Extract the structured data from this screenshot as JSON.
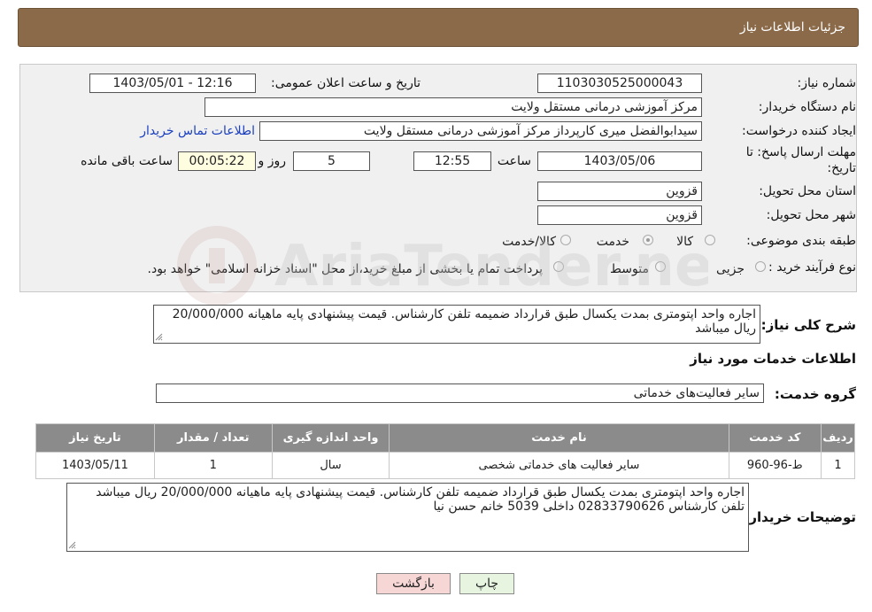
{
  "header": {
    "title": "جزئیات اطلاعات نیاز"
  },
  "fields": {
    "need_number_label": "شماره نیاز:",
    "need_number": "1103030525000043",
    "announce_label": "تاریخ و ساعت اعلان عمومی:",
    "announce_value": "1403/05/01 - 12:16",
    "buyer_org_label": "نام دستگاه خریدار:",
    "buyer_org": "مرکز آموزشی درمانی مستقل ولایت",
    "requester_label": "ایجاد کننده درخواست:",
    "requester": "سیدابوالفضل میری کارپرداز مرکز آموزشی درمانی مستقل ولایت",
    "contact_link": "اطلاعات تماس خریدار",
    "deadline_label_1": "مهلت ارسال پاسخ: تا",
    "deadline_label_2": "تاریخ:",
    "deadline_date": "1403/05/06",
    "time_label": "ساعت",
    "deadline_time": "12:55",
    "days_value": "5",
    "days_label": "روز و",
    "remaining_time": "00:05:22",
    "remaining_label": "ساعت باقی مانده",
    "province_label": "استان محل تحویل:",
    "province": "قزوین",
    "city_label": "شهر محل تحویل:",
    "city": "قزوین",
    "category_label": "طبقه بندی موضوعی:",
    "category_options": [
      "کالا",
      "خدمت",
      "کالا/خدمت"
    ],
    "process_label": "نوع فرآیند خرید :",
    "process_options": [
      "جزیی",
      "متوسط"
    ],
    "process_note": "پرداخت تمام یا بخشی از مبلغ خرید،از محل \"اسناد خزانه اسلامی\" خواهد بود."
  },
  "summary": {
    "label": "شرح کلی نیاز:",
    "text": "اجاره واحد اپتومتری بمدت یکسال طبق قرارداد ضمیمه تلفن کارشناس. قیمت پیشنهادی پایه ماهیانه 20/000/000 ریال میباشد"
  },
  "services": {
    "section_title": "اطلاعات خدمات مورد نیاز",
    "group_label": "گروه خدمت:",
    "group_value": "سایر فعالیت‌های خدماتی",
    "columns": [
      "ردیف",
      "کد خدمت",
      "نام خدمت",
      "واحد اندازه گیری",
      "تعداد / مقدار",
      "تاریخ نیاز"
    ],
    "rows": [
      [
        "1",
        "ط-96-960",
        "سایر فعالیت های خدماتی شخصی",
        "سال",
        "1",
        "1403/05/11"
      ]
    ]
  },
  "buyer_notes": {
    "label": "توضیحات خریدار:",
    "text": "اجاره واحد اپتومتری بمدت یکسال طبق قرارداد ضمیمه تلفن کارشناس. قیمت پیشنهادی پایه ماهیانه 20/000/000 ریال میباشد تلفن کارشناس 02833790626 داخلی 5039 خانم حسن نیا"
  },
  "buttons": {
    "print": "چاپ",
    "back": "بازگشت"
  },
  "watermark": {
    "text": "AriaTender.net"
  },
  "colors": {
    "header_bg": "#8b6a4a",
    "table_header_bg": "#8b8b8b",
    "link": "#1a3fbf",
    "back_button_bg": "#f7d6d6",
    "print_button_bg": "#e6f4e0"
  }
}
